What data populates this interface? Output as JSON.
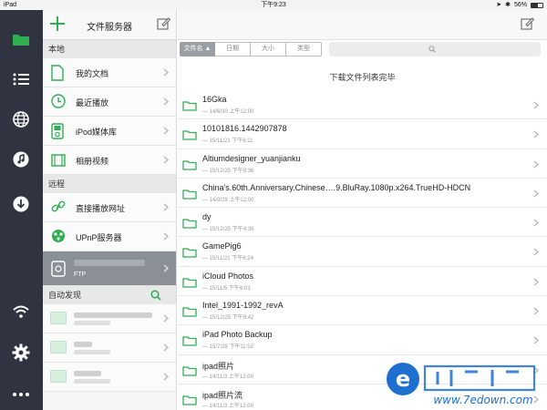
{
  "statusbar": {
    "device": "iPad",
    "time": "下午9:23",
    "battery": "56%"
  },
  "sidebar": {
    "title": "文件服务器",
    "section_local": "本地",
    "local_items": [
      {
        "label": "我的文档"
      },
      {
        "label": "最近播放"
      },
      {
        "label": "iPod媒体库"
      },
      {
        "label": "相册视频"
      }
    ],
    "section_remote": "远程",
    "remote_items": [
      {
        "label": "直接播放网址"
      },
      {
        "label": "UPnP服务器"
      }
    ],
    "selected_server_type": "FTP",
    "section_discover": "自动发现"
  },
  "main": {
    "sort_tabs": [
      "文件名 ▲",
      "日期",
      "大小",
      "类型"
    ],
    "status": "下载文件列表完毕",
    "files": [
      {
        "name": "16Gka",
        "meta": "— 14/6/30 上午12:00"
      },
      {
        "name": "10101816.1442907878",
        "meta": "— 15/11/21 下午6:11"
      },
      {
        "name": "Altiumdesigner_yuanjianku",
        "meta": "— 15/12/25 下午9:36"
      },
      {
        "name": "China's.60th.Anniversary.Chinese….9.BluRay.1080p.x264.TrueHD-HDCN",
        "meta": "— 14/9/29 上午12:00"
      },
      {
        "name": "dy",
        "meta": "— 15/12/25 下午4:39"
      },
      {
        "name": "GamePig6",
        "meta": "— 15/11/21 下午6:24"
      },
      {
        "name": "iCloud Photos",
        "meta": "— 15/11/5 下午6:03"
      },
      {
        "name": "Intel_1991-1992_revA",
        "meta": "— 15/12/25 下午9:42"
      },
      {
        "name": "iPad Photo Backup",
        "meta": "— 15/7/29 下午11:52"
      },
      {
        "name": "ipad照片",
        "meta": "— 14/11/3 上午12:00"
      },
      {
        "name": "ipad照片流",
        "meta": "— 14/11/3 上午12:00"
      }
    ]
  },
  "watermark": {
    "text": "www.7edown.com"
  },
  "colors": {
    "accent": "#2fae52",
    "rail": "#2f3440"
  }
}
